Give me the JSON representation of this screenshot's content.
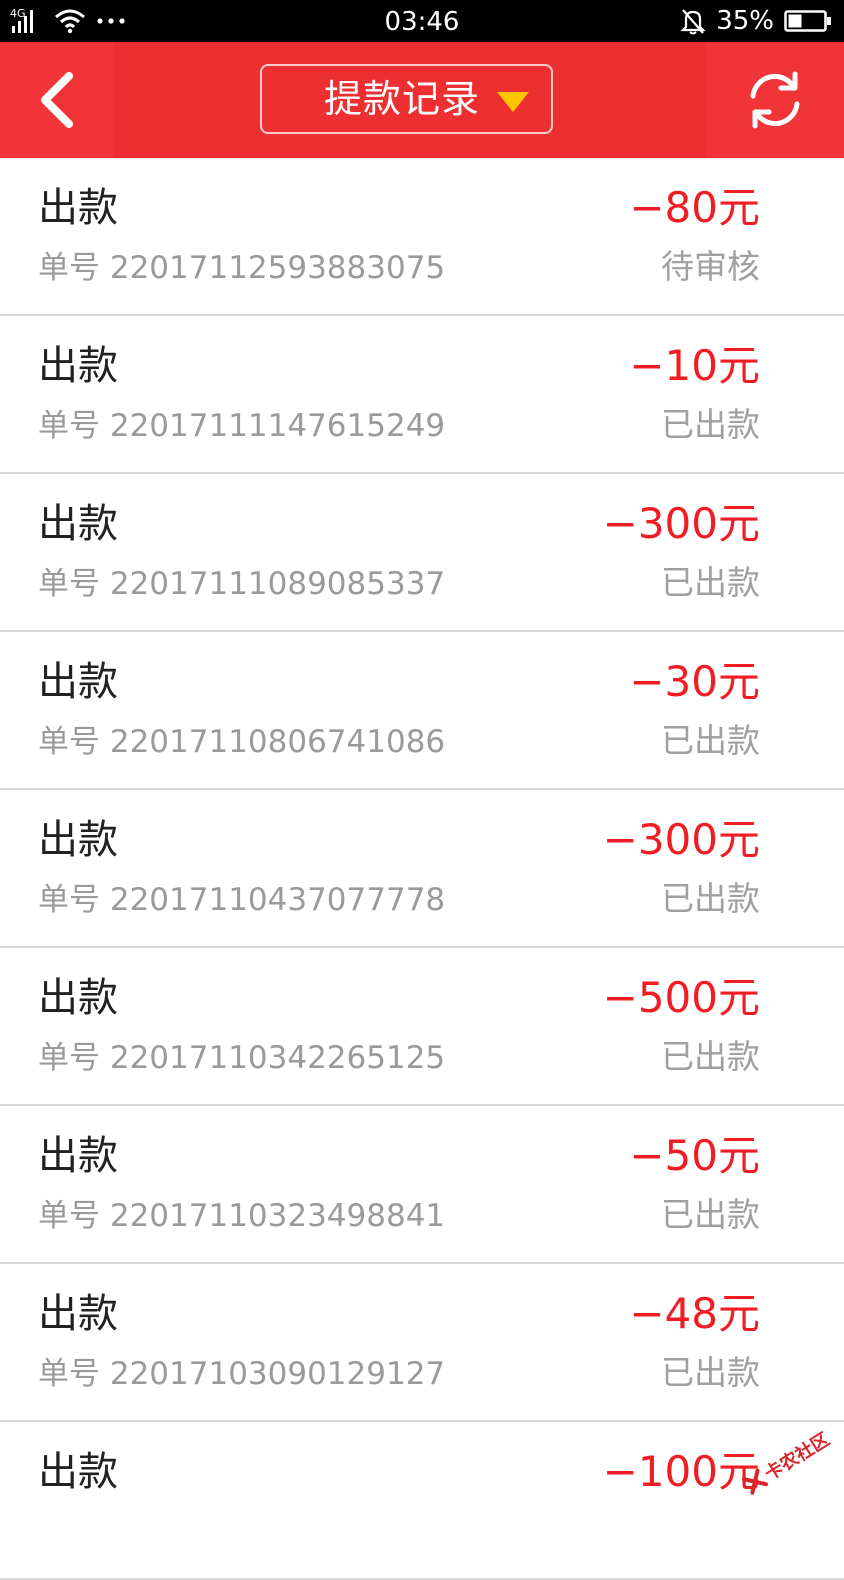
{
  "status_bar": {
    "network": "4G",
    "time": "03:46",
    "battery": "35%"
  },
  "header": {
    "title": "提款记录",
    "back_icon": "chevron-left-icon",
    "dropdown_icon": "caret-down-icon",
    "refresh_icon": "refresh-icon"
  },
  "colors": {
    "header_bg": "#ee2f32",
    "amount": "#f21d23",
    "caret": "#ffc600"
  },
  "records": [
    {
      "type": "出款",
      "order": "单号 22017112593883075",
      "amount": "−80元",
      "status": "待审核"
    },
    {
      "type": "出款",
      "order": "单号 22017111147615249",
      "amount": "−10元",
      "status": "已出款"
    },
    {
      "type": "出款",
      "order": "单号 22017111089085337",
      "amount": "−300元",
      "status": "已出款"
    },
    {
      "type": "出款",
      "order": "单号 22017110806741086",
      "amount": "−30元",
      "status": "已出款"
    },
    {
      "type": "出款",
      "order": "单号 22017110437077778",
      "amount": "−300元",
      "status": "已出款"
    },
    {
      "type": "出款",
      "order": "单号 22017110342265125",
      "amount": "−500元",
      "status": "已出款"
    },
    {
      "type": "出款",
      "order": "单号 22017110323498841",
      "amount": "−50元",
      "status": "已出款"
    },
    {
      "type": "出款",
      "order": "单号 22017103090129127",
      "amount": "−48元",
      "status": "已出款"
    },
    {
      "type": "出款",
      "order": "",
      "amount": "−100元",
      "status": ""
    }
  ],
  "watermark": {
    "text": "卡农社区"
  }
}
